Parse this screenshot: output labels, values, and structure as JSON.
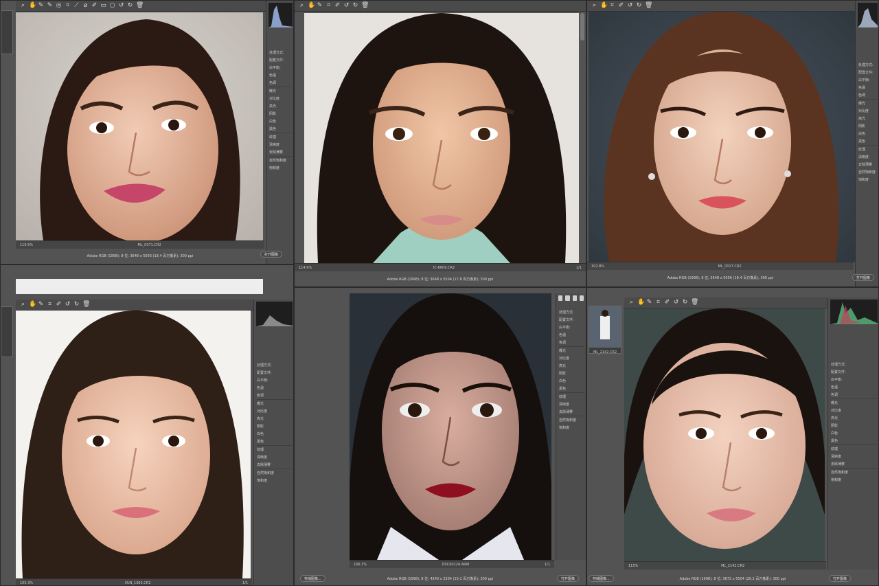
{
  "windows": [
    {
      "id": "w1",
      "zoom": "119.5%",
      "filename": "ML_0371.CR2",
      "status_info": "Adobe RGB (1998); 8 位; 3648 x 5056 (18.4 百万像素); 300 ppi",
      "open_button": "打开图像",
      "panel_items": [
        "处理方式:",
        "配置文件:",
        "白平衡:",
        "色温",
        "色调",
        "曝光",
        "对比度",
        "高光",
        "阴影",
        "白色",
        "黑色",
        "纹理",
        "清晰度",
        "去除薄雾",
        "自然饱和度",
        "饱和度"
      ]
    },
    {
      "id": "w2",
      "zoom": "114.9%",
      "filename": "IC-6609.CR2",
      "status_info": "Adobe RGB (1998); 8 位; 3648 x 5504 (17.8 百万像素); 300 ppi",
      "page": "1/1"
    },
    {
      "id": "w3",
      "zoom": "102.8%",
      "filename": "ML_0017.CR2",
      "status_info": "Adobe RGB (1998); 8 位; 3648 x 5056 (18.4 百万像素); 300 ppi",
      "open_button": "打开图像",
      "panel_items": [
        "处理方式:",
        "配置文件:",
        "白平衡:",
        "色温",
        "色调",
        "曝光",
        "对比度",
        "高光",
        "阴影",
        "白色",
        "黑色",
        "纹理",
        "清晰度",
        "去除薄雾",
        "自然饱和度",
        "饱和度"
      ]
    },
    {
      "id": "w4",
      "zoom": "105.3%",
      "filename": "XUN_1365.CR2",
      "page": "1/1",
      "panel_items": [
        "处理方式:",
        "配置文件:",
        "白平衡:",
        "色温",
        "色调",
        "曝光",
        "对比度",
        "高光",
        "阴影",
        "白色",
        "黑色",
        "纹理",
        "清晰度",
        "去除薄雾",
        "自然饱和度",
        "饱和度"
      ]
    },
    {
      "id": "w5",
      "zoom": "166.3%",
      "filename": "DSC00124.ARW",
      "status_info": "Adobe RGB (1998); 8 位; 4240 x 2304 (10.1 百万像素); 300 ppi",
      "page": "1/1",
      "save_button": "存储图像...",
      "open_button": "打开图像",
      "panel_items": [
        "处理方式:",
        "配置文件:",
        "白平衡:",
        "色温",
        "色调",
        "曝光",
        "对比度",
        "高光",
        "阴影",
        "白色",
        "黑色",
        "纹理",
        "清晰度",
        "去除薄雾",
        "自然饱和度",
        "饱和度"
      ]
    },
    {
      "id": "w6",
      "zoom": "115%",
      "filename": "ML_2142.CR2",
      "status_info": "Adobe RGB (1998); 8 位; 3672 x 5504 (20.2 百万像素); 300 ppi",
      "save_button": "存储图像...",
      "open_button": "打开图像",
      "filmstrip_label": "ML_2142.CR2",
      "panel_items": [
        "处理方式:",
        "配置文件:",
        "白平衡:",
        "色温",
        "色调",
        "曝光",
        "对比度",
        "高光",
        "阴影",
        "白色",
        "黑色",
        "纹理",
        "清晰度",
        "去除薄雾",
        "自然饱和度",
        "饱和度"
      ]
    }
  ],
  "colors": {
    "ui_bg": "#535353",
    "panel_bg": "#4d4d4d",
    "toolbar_bg": "#4a4a4a",
    "hist_bg": "#1e1e1e",
    "accent": "#6aa0e8"
  },
  "icons": [
    "zoom-icon",
    "hand-icon",
    "white-balance-icon",
    "color-sampler-icon",
    "target-adjust-icon",
    "crop-icon",
    "straighten-icon",
    "spot-removal-icon",
    "red-eye-icon",
    "brush-icon",
    "graduated-filter-icon",
    "radial-filter-icon",
    "rotate-left-icon",
    "rotate-right-icon",
    "trash-icon"
  ]
}
